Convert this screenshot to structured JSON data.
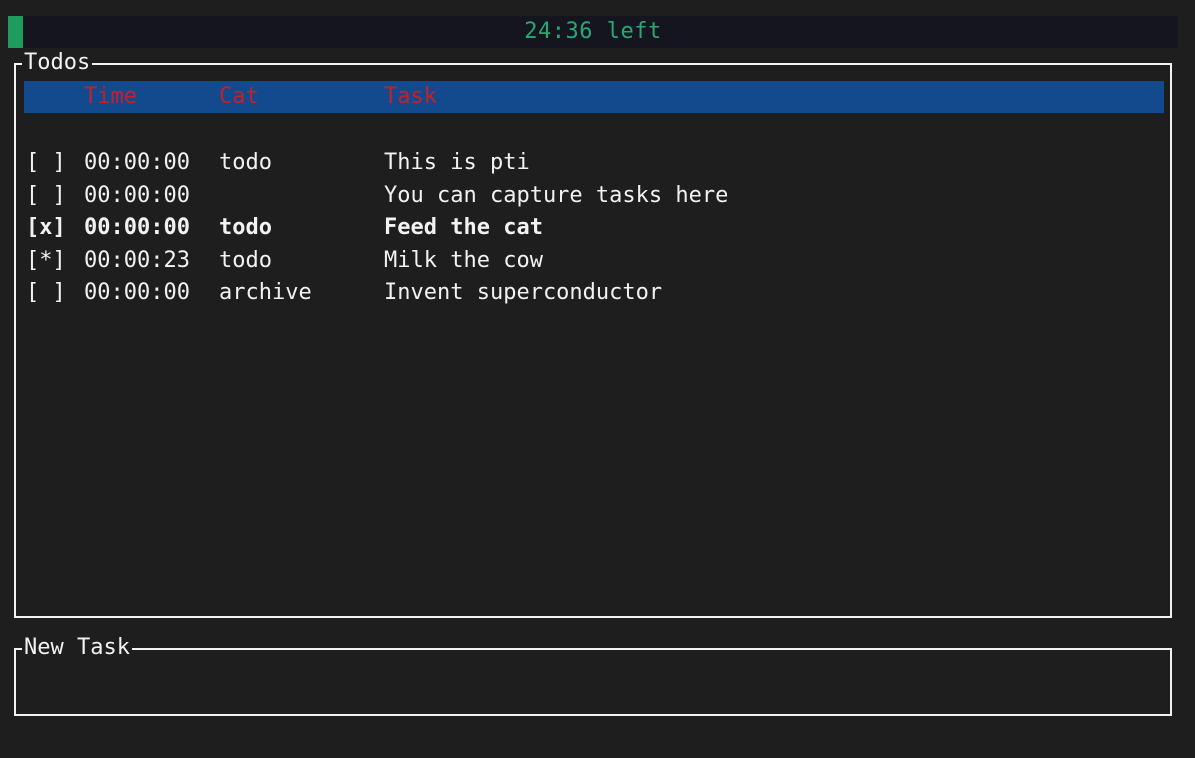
{
  "timer": {
    "label": "24:36 left",
    "progress_fraction": 0.013,
    "color": "#1f9c5d"
  },
  "todos_panel": {
    "title": "Todos",
    "columns": {
      "check": "",
      "time": "Time",
      "cat": "Cat",
      "task": "Task"
    },
    "header_bg": "#134a8e",
    "header_fg": "#c4202c",
    "rows": [
      {
        "check": "[ ]",
        "time": "00:00:00",
        "cat": "todo",
        "task": "This is pti",
        "selected": false
      },
      {
        "check": "[ ]",
        "time": "00:00:00",
        "cat": "",
        "task": "You can capture tasks here",
        "selected": false
      },
      {
        "check": "[x]",
        "time": "00:00:00",
        "cat": "todo",
        "task": "Feed the cat",
        "selected": true
      },
      {
        "check": "[*]",
        "time": "00:00:23",
        "cat": "todo",
        "task": "Milk the cow",
        "selected": false
      },
      {
        "check": "[ ]",
        "time": "00:00:00",
        "cat": "archive",
        "task": "Invent superconductor",
        "selected": false
      }
    ]
  },
  "new_task_panel": {
    "title": "New Task",
    "value": ""
  }
}
